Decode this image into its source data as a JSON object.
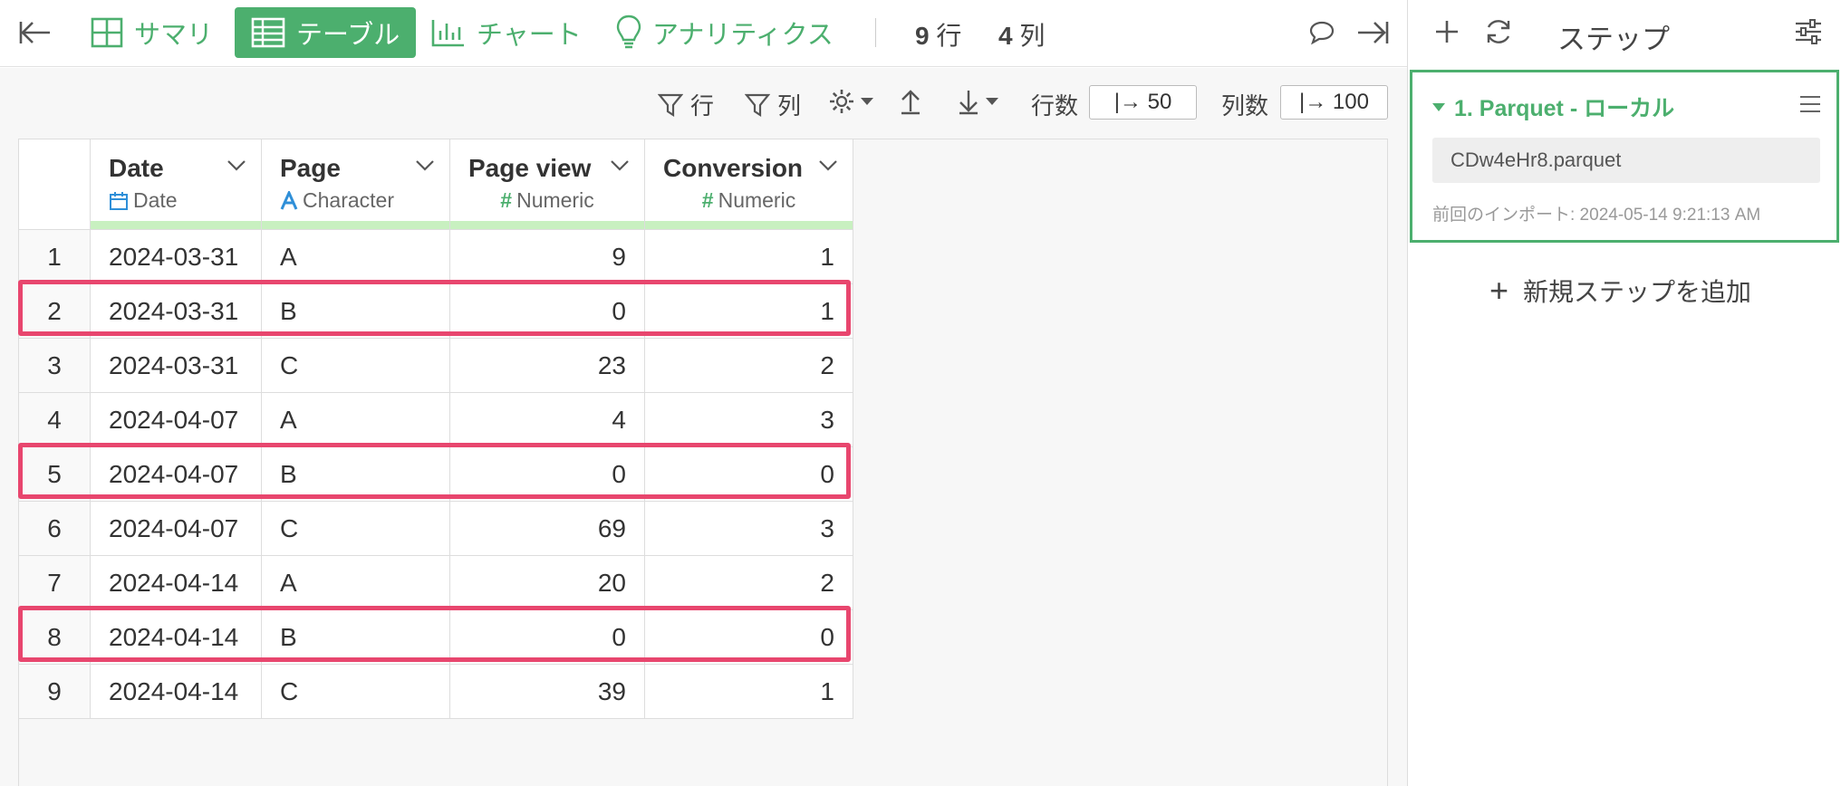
{
  "toolbar": {
    "tabs": [
      {
        "label": "サマリ"
      },
      {
        "label": "テーブル"
      },
      {
        "label": "チャート"
      },
      {
        "label": "アナリティクス"
      }
    ],
    "row_count": "9",
    "row_unit": "行",
    "col_count": "4",
    "col_unit": "列"
  },
  "subtoolbar": {
    "filter_rows_label": "行",
    "filter_cols_label": "列",
    "rows_label": "行数",
    "rows_value": "|→ 50",
    "cols_label": "列数",
    "cols_value": "|→ 100"
  },
  "table": {
    "columns": [
      {
        "name": "Date",
        "type": "Date"
      },
      {
        "name": "Page",
        "type": "Character"
      },
      {
        "name": "Page view",
        "type": "Numeric"
      },
      {
        "name": "Conversion",
        "type": "Numeric"
      }
    ],
    "rows": [
      {
        "n": "1",
        "date": "2024-03-31",
        "page": "A",
        "pv": "9",
        "cv": "1"
      },
      {
        "n": "2",
        "date": "2024-03-31",
        "page": "B",
        "pv": "0",
        "cv": "1"
      },
      {
        "n": "3",
        "date": "2024-03-31",
        "page": "C",
        "pv": "23",
        "cv": "2"
      },
      {
        "n": "4",
        "date": "2024-04-07",
        "page": "A",
        "pv": "4",
        "cv": "3"
      },
      {
        "n": "5",
        "date": "2024-04-07",
        "page": "B",
        "pv": "0",
        "cv": "0"
      },
      {
        "n": "6",
        "date": "2024-04-07",
        "page": "C",
        "pv": "69",
        "cv": "3"
      },
      {
        "n": "7",
        "date": "2024-04-14",
        "page": "A",
        "pv": "20",
        "cv": "2"
      },
      {
        "n": "8",
        "date": "2024-04-14",
        "page": "B",
        "pv": "0",
        "cv": "0"
      },
      {
        "n": "9",
        "date": "2024-04-14",
        "page": "C",
        "pv": "39",
        "cv": "1"
      }
    ],
    "highlight_color": "#e8466e"
  },
  "sidebar": {
    "title": "ステップ",
    "step": {
      "title": "1. Parquet - ローカル",
      "file": "CDw4eHr8.parquet",
      "meta": "前回のインポート: 2024-05-14 9:21:13 AM"
    },
    "add_step_label": "新規ステップを追加"
  },
  "colors": {
    "accent": "#4caf6e",
    "header_bar": "#c8f0c0"
  }
}
